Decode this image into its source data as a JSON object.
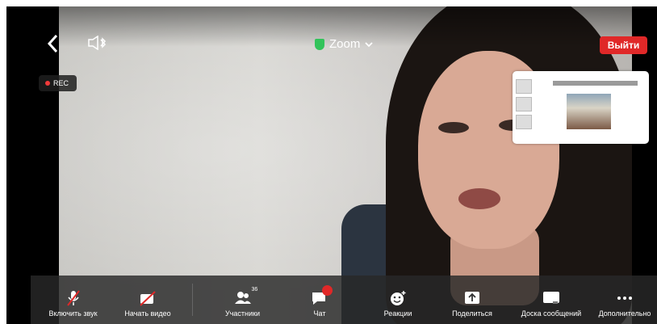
{
  "header": {
    "back_icon": "chevron-left-icon",
    "speaker_icon": "speaker-bluetooth-icon",
    "meeting_title": "Zoom",
    "leave_label": "Выйти"
  },
  "recording": {
    "label": "REC"
  },
  "toolbar": {
    "items": [
      {
        "label": "Включить звук",
        "icon": "microphone-muted-icon"
      },
      {
        "label": "Начать видео",
        "icon": "camera-off-icon"
      },
      {
        "label": "Участники",
        "icon": "participants-icon",
        "count": "36"
      },
      {
        "label": "Чат",
        "icon": "chat-icon"
      },
      {
        "label": "Реакции",
        "icon": "reactions-icon"
      },
      {
        "label": "Поделиться",
        "icon": "share-icon"
      },
      {
        "label": "Доска сообщений",
        "icon": "whiteboard-icon"
      },
      {
        "label": "Дополнительно",
        "icon": "more-icon"
      }
    ]
  },
  "colors": {
    "leave": "#e02828",
    "shield": "#32c35a",
    "rec_dot": "#f03a3a"
  }
}
